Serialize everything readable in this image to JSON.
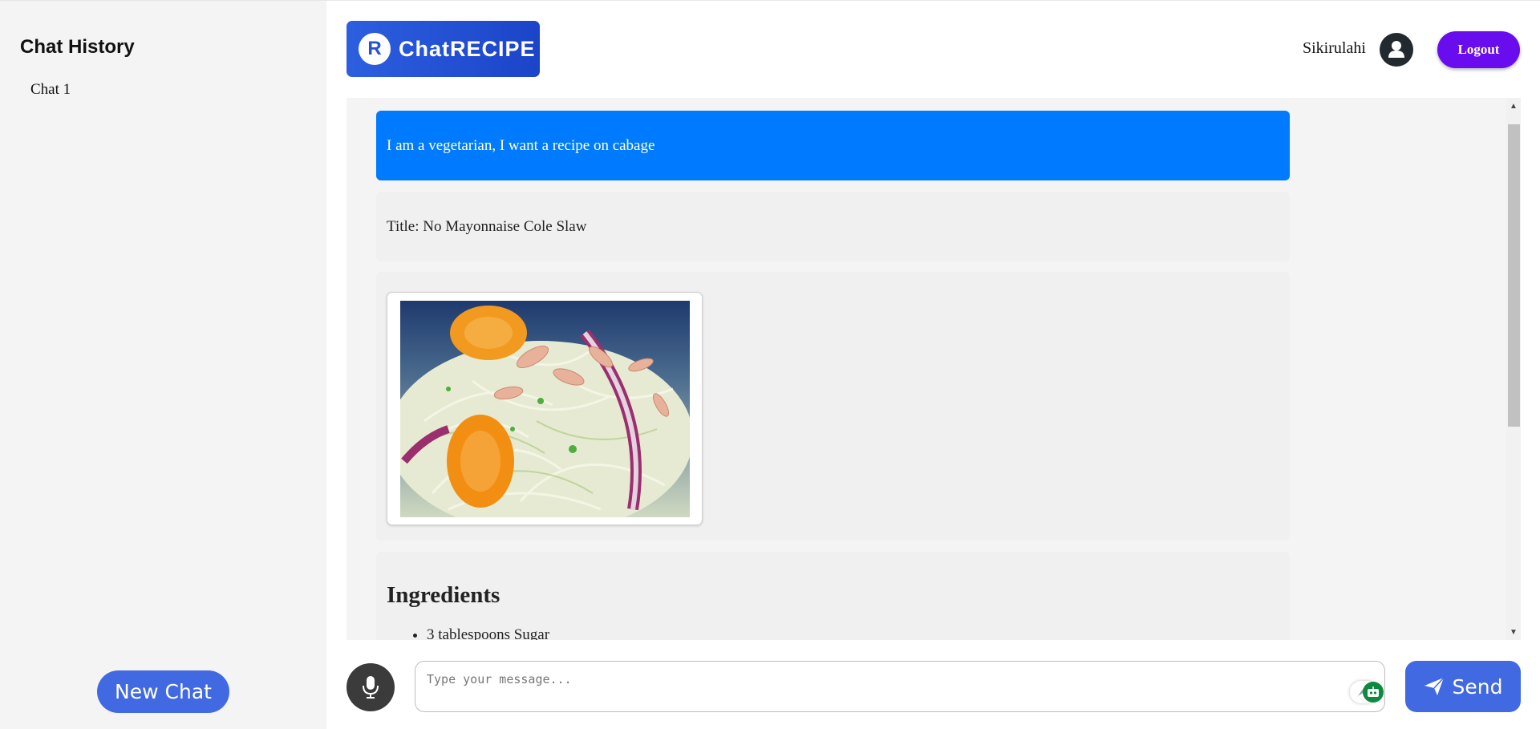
{
  "sidebar": {
    "title": "Chat History",
    "chats": [
      "Chat 1"
    ],
    "new_chat_label": "New Chat"
  },
  "header": {
    "logo_letter": "R",
    "logo_text": "ChatRECIPE",
    "username": "Sikirulahi",
    "avatar_icon": "user-icon",
    "logout_label": "Logout"
  },
  "messages": {
    "user_message": "I am a vegetarian, I want a recipe on cabage",
    "title_message": "Title: No Mayonnaise Cole Slaw",
    "image_alt": "No Mayonnaise Cole Slaw",
    "ingredients_heading": "Ingredients",
    "ingredients": [
      "3 tablespoons Sugar"
    ]
  },
  "composer": {
    "placeholder": "Type your message...",
    "mic_icon": "microphone-icon",
    "send_label": "Send",
    "send_icon": "paper-plane-icon"
  },
  "colors": {
    "user_bubble": "#007bff",
    "logo": "#2453d6",
    "logout": "#6a0dee",
    "primary_button": "#4169e1"
  }
}
